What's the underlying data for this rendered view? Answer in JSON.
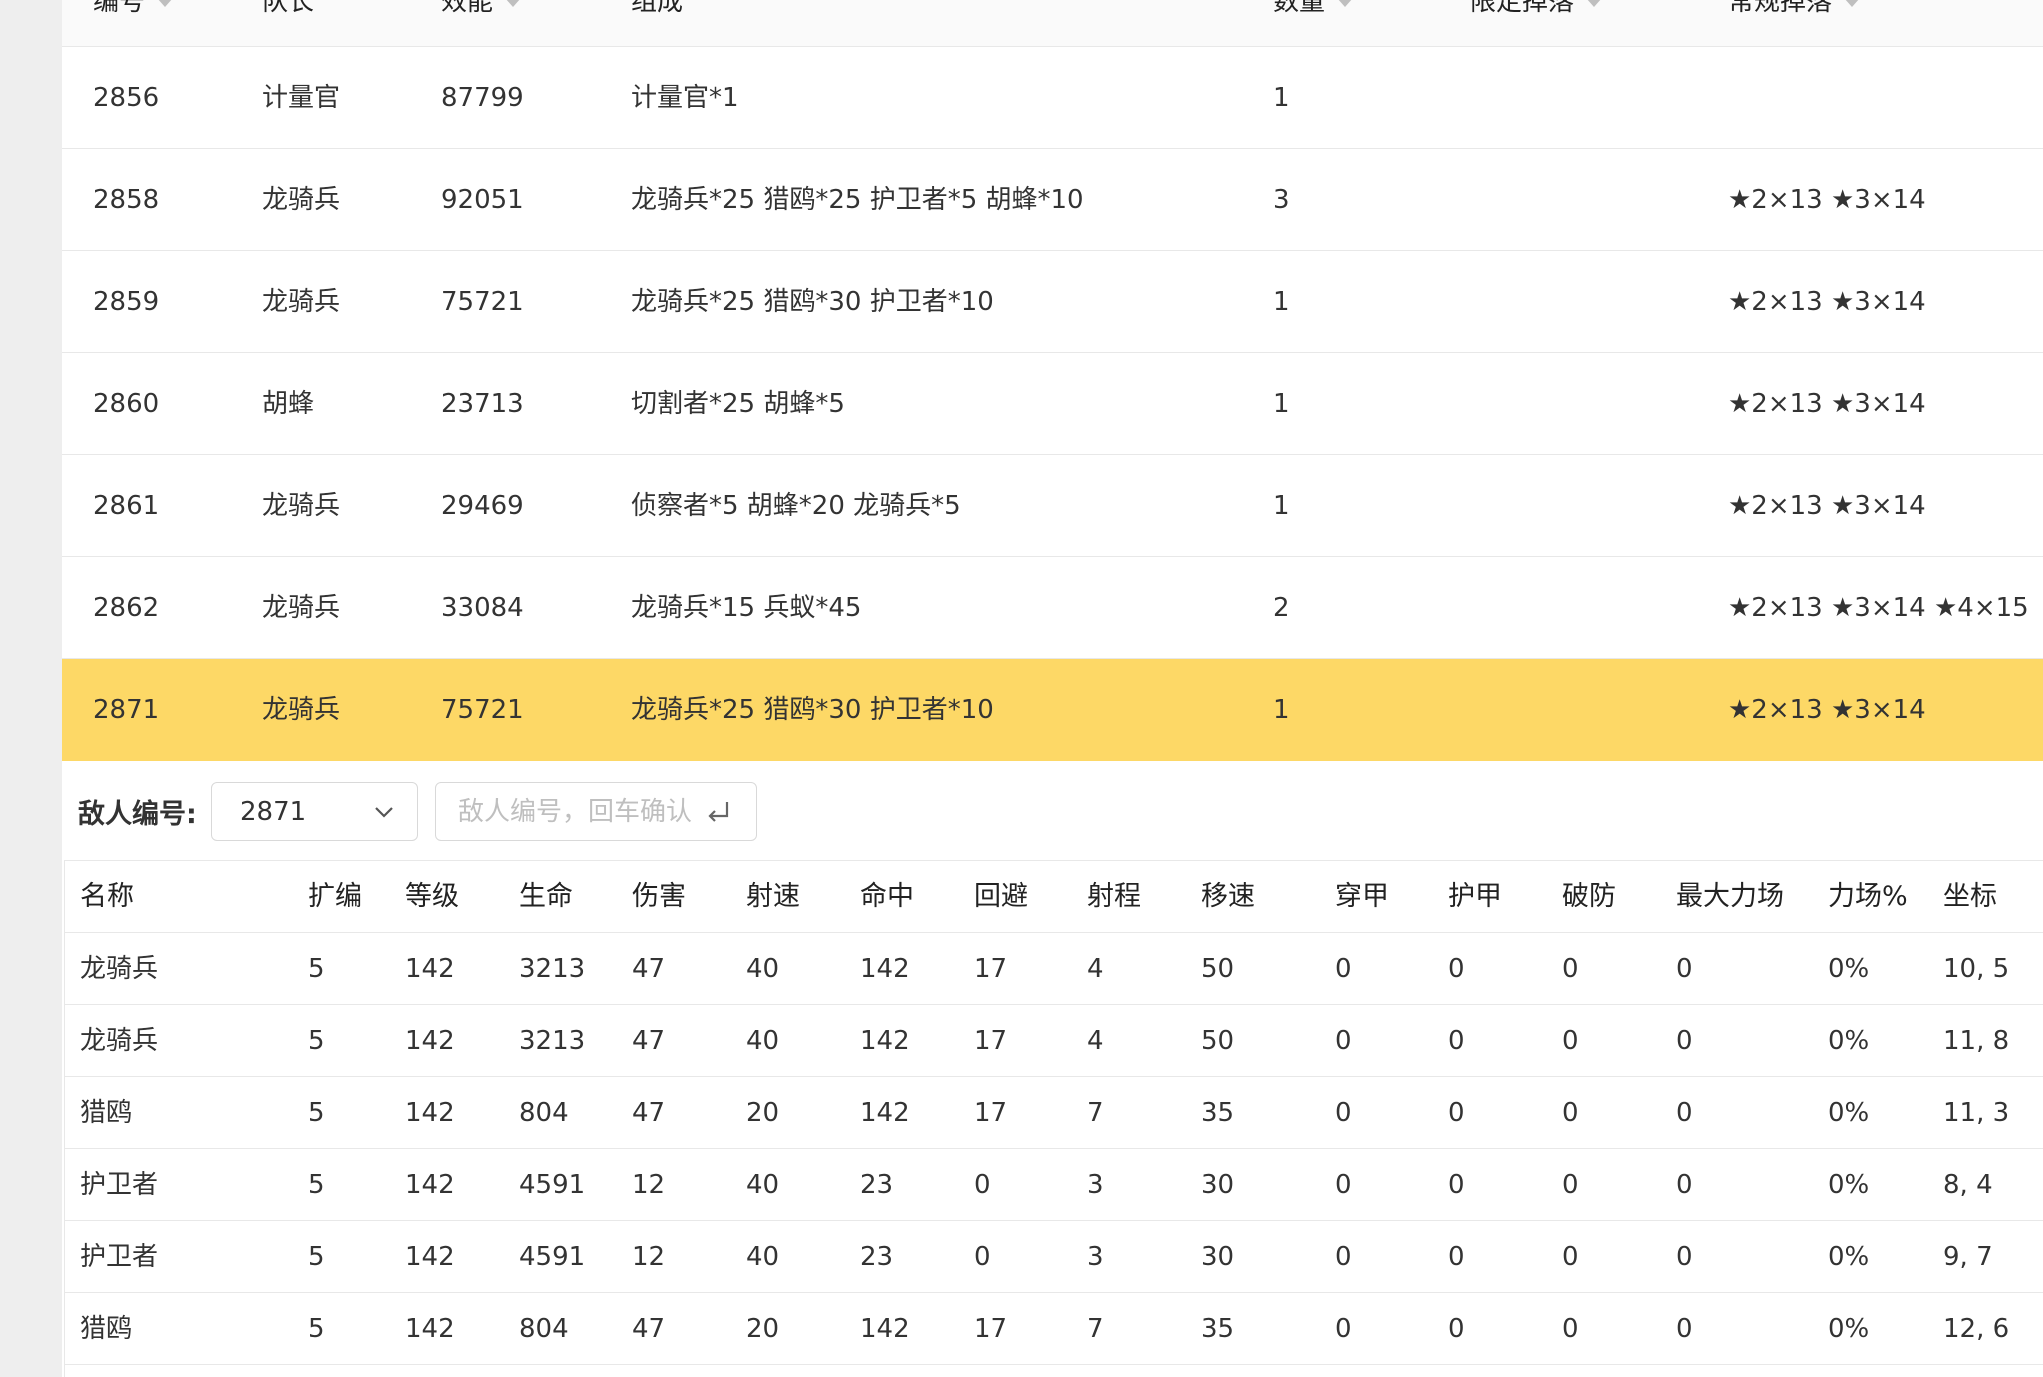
{
  "top_table": {
    "columns": [
      {
        "label": "编号",
        "sortable": true
      },
      {
        "label": "队长",
        "sortable": false
      },
      {
        "label": "效能",
        "sortable": true
      },
      {
        "label": "组成",
        "sortable": false
      },
      {
        "label": "数量",
        "sortable": true
      },
      {
        "label": "限定掉落",
        "sortable": true
      },
      {
        "label": "常规掉落",
        "sortable": true
      }
    ],
    "rows": [
      {
        "id": "2856",
        "leader": "计量官",
        "power": "87799",
        "composition": "计量官*1",
        "count": "1",
        "limited_drop": "",
        "normal_drop": "",
        "selected": false
      },
      {
        "id": "2858",
        "leader": "龙骑兵",
        "power": "92051",
        "composition": "龙骑兵*25 猎鸥*25 护卫者*5 胡蜂*10",
        "count": "3",
        "limited_drop": "",
        "normal_drop": "★2×13 ★3×14",
        "selected": false
      },
      {
        "id": "2859",
        "leader": "龙骑兵",
        "power": "75721",
        "composition": "龙骑兵*25 猎鸥*30 护卫者*10",
        "count": "1",
        "limited_drop": "",
        "normal_drop": "★2×13 ★3×14",
        "selected": false
      },
      {
        "id": "2860",
        "leader": "胡蜂",
        "power": "23713",
        "composition": "切割者*25 胡蜂*5",
        "count": "1",
        "limited_drop": "",
        "normal_drop": "★2×13 ★3×14",
        "selected": false
      },
      {
        "id": "2861",
        "leader": "龙骑兵",
        "power": "29469",
        "composition": "侦察者*5 胡蜂*20 龙骑兵*5",
        "count": "1",
        "limited_drop": "",
        "normal_drop": "★2×13 ★3×14",
        "selected": false
      },
      {
        "id": "2862",
        "leader": "龙骑兵",
        "power": "33084",
        "composition": "龙骑兵*15 兵蚁*45",
        "count": "2",
        "limited_drop": "",
        "normal_drop": "★2×13 ★3×14 ★4×15",
        "selected": false
      },
      {
        "id": "2871",
        "leader": "龙骑兵",
        "power": "75721",
        "composition": "龙骑兵*25 猎鸥*30 护卫者*10",
        "count": "1",
        "limited_drop": "",
        "normal_drop": "★2×13 ★3×14",
        "selected": true
      }
    ]
  },
  "selector": {
    "label": "敌人编号:",
    "selected_value": "2871",
    "input_placeholder": "敌人编号，回车确认"
  },
  "unit_table": {
    "columns": [
      "名称",
      "扩编",
      "等级",
      "生命",
      "伤害",
      "射速",
      "命中",
      "回避",
      "射程",
      "移速",
      "穿甲",
      "护甲",
      "破防",
      "最大力场",
      "力场%",
      "坐标"
    ],
    "rows": [
      [
        "龙骑兵",
        "5",
        "142",
        "3213",
        "47",
        "40",
        "142",
        "17",
        "4",
        "50",
        "0",
        "0",
        "0",
        "0",
        "0%",
        "10, 5"
      ],
      [
        "龙骑兵",
        "5",
        "142",
        "3213",
        "47",
        "40",
        "142",
        "17",
        "4",
        "50",
        "0",
        "0",
        "0",
        "0",
        "0%",
        "11, 8"
      ],
      [
        "猎鸥",
        "5",
        "142",
        "804",
        "47",
        "20",
        "142",
        "17",
        "7",
        "35",
        "0",
        "0",
        "0",
        "0",
        "0%",
        "11, 3"
      ],
      [
        "护卫者",
        "5",
        "142",
        "4591",
        "12",
        "40",
        "23",
        "0",
        "3",
        "30",
        "0",
        "0",
        "0",
        "0",
        "0%",
        "8, 4"
      ],
      [
        "护卫者",
        "5",
        "142",
        "4591",
        "12",
        "40",
        "23",
        "0",
        "3",
        "30",
        "0",
        "0",
        "0",
        "0",
        "0%",
        "9, 7"
      ],
      [
        "猎鸥",
        "5",
        "142",
        "804",
        "47",
        "20",
        "142",
        "17",
        "7",
        "35",
        "0",
        "0",
        "0",
        "0",
        "0%",
        "12, 6"
      ]
    ]
  },
  "colors": {
    "selected_row": "#fdd866",
    "border": "#e8e8e8",
    "header_bg": "#fafafa",
    "side_strip": "#eeeeee"
  }
}
